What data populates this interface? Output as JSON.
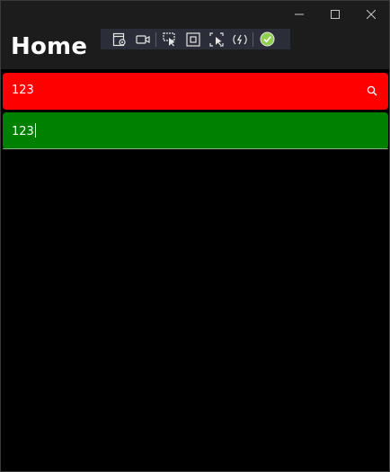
{
  "window": {
    "minimize_icon": "minimize-icon",
    "maximize_icon": "maximize-icon",
    "close_icon": "close-icon"
  },
  "header": {
    "title": "Home"
  },
  "debug_toolbar": {
    "icons": [
      "live-visual-tree-icon",
      "video-icon",
      "select-element-icon",
      "display-layout-adorners-icon",
      "track-focused-element-icon",
      "hot-reload-icon",
      "in-sync-check-icon"
    ]
  },
  "search_bar": {
    "value": "123",
    "background": "#ff0000",
    "icon": "search-icon"
  },
  "entry": {
    "value": "123",
    "background": "#008000"
  },
  "colors": {
    "page_background": "#000000",
    "titlebar_background": "#1c1c1c",
    "text": "#ffffff",
    "toolbar_background": "#2b2e38",
    "check_badge": "#8fd14f"
  }
}
